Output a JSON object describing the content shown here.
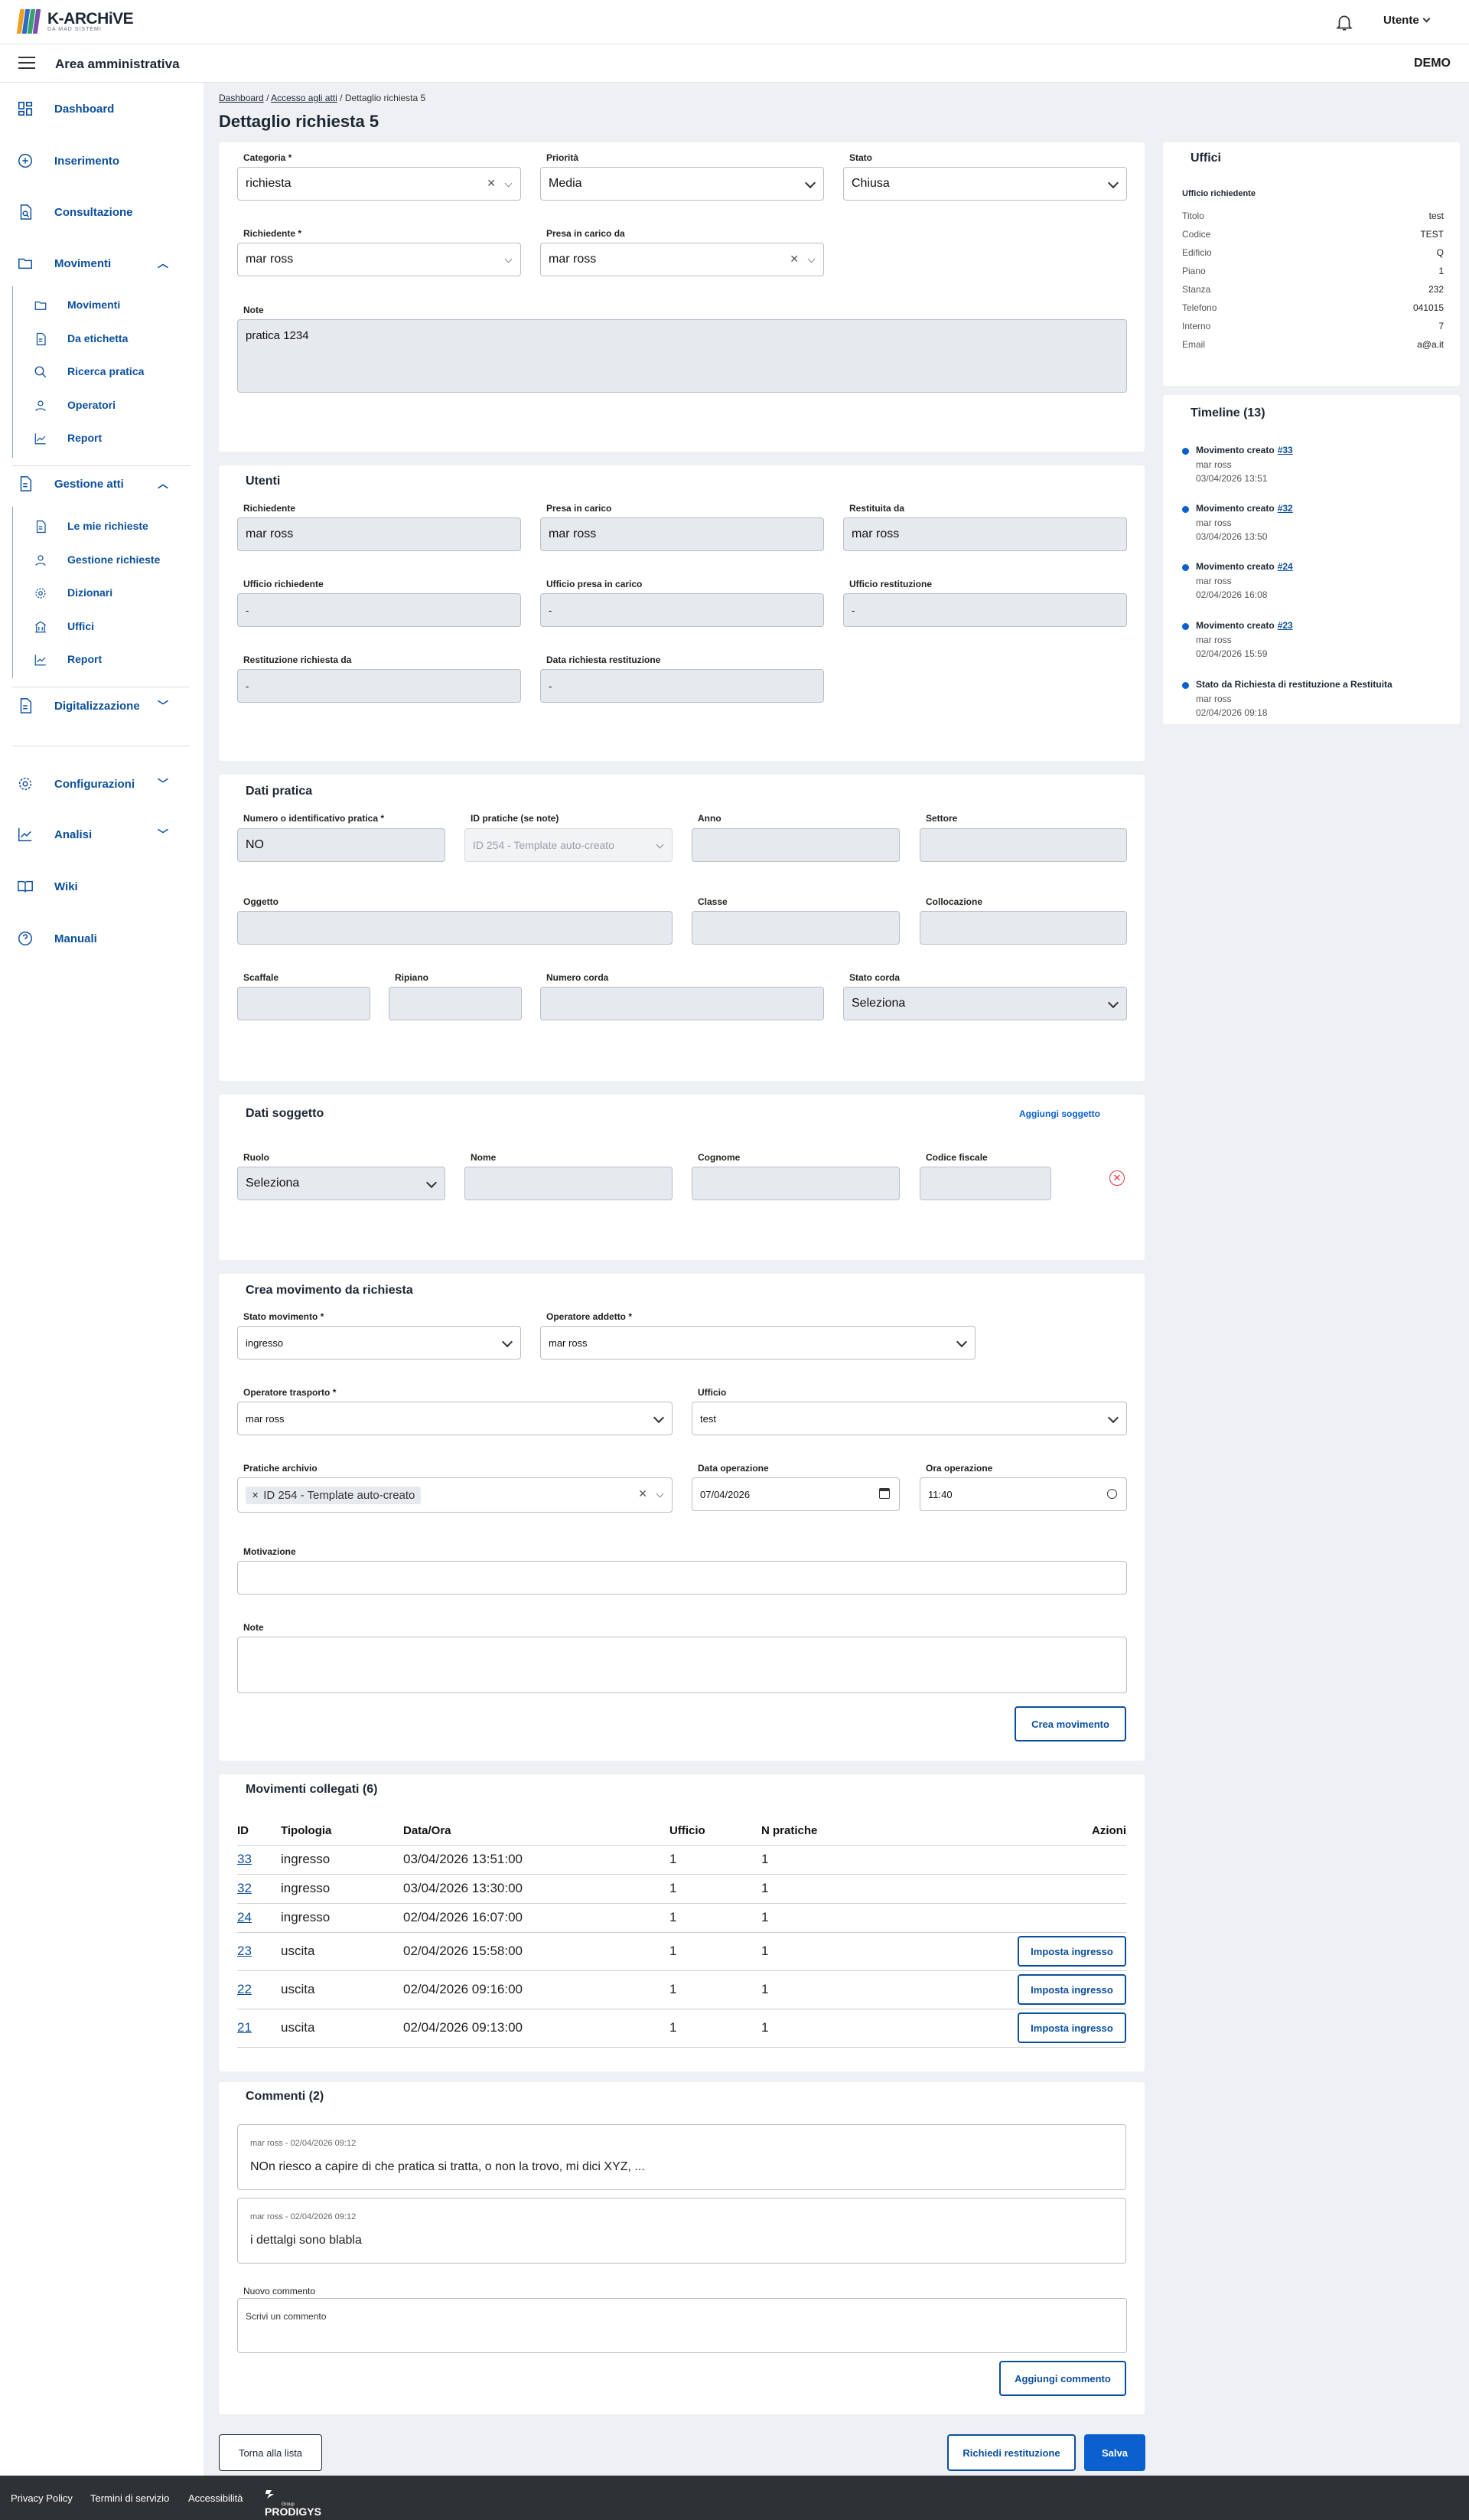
{
  "header": {
    "logo_name": "K-ARCHiVE",
    "logo_sub": "DA MAD SISTEMI",
    "user_menu": "Utente",
    "area_title": "Area amministrativa",
    "org": "DEMO"
  },
  "sidebar": {
    "dashboard": "Dashboard",
    "inserimento": "Inserimento",
    "consultazione": "Consultazione",
    "movimenti": "Movimenti",
    "movimenti_items": [
      "Movimenti",
      "Da etichetta",
      "Ricerca pratica",
      "Operatori",
      "Report"
    ],
    "gestione_atti": "Gestione atti",
    "gestione_items": [
      "Le mie richieste",
      "Gestione richieste",
      "Dizionari",
      "Uffici",
      "Report"
    ],
    "digitalizzazione": "Digitalizzazione",
    "configurazioni": "Configurazioni",
    "analisi": "Analisi",
    "wiki": "Wiki",
    "manuali": "Manuali"
  },
  "breadcrumb": {
    "b1": "Dashboard",
    "b2": "Accesso agli atti",
    "b3": "Dettaglio richiesta 5"
  },
  "page_title": "Dettaglio richiesta 5",
  "richiesta": {
    "categoria_label": "Categoria *",
    "categoria": "richiesta",
    "priorita_label": "Priorità",
    "priorita": "Media",
    "stato_label": "Stato",
    "stato": "Chiusa",
    "richiedente_label": "Richiedente *",
    "richiedente": "mar ross",
    "presa_label": "Presa in carico da",
    "presa": "mar ross",
    "note_label": "Note",
    "note": "pratica 1234"
  },
  "utenti": {
    "title": "Utenti",
    "richiedente_label": "Richiedente",
    "richiedente": "mar ross",
    "presa_label": "Presa in carico",
    "presa": "mar ross",
    "restituita_label": "Restituita da",
    "restituita": "mar ross",
    "uff_rich_label": "Ufficio richiedente",
    "uff_rich": "-",
    "uff_presa_label": "Ufficio presa in carico",
    "uff_presa": "-",
    "uff_rest_label": "Ufficio restituzione",
    "uff_rest": "-",
    "rest_rich_label": "Restituzione richiesta da",
    "rest_rich": "-",
    "data_rest_label": "Data richiesta restituzione",
    "data_rest": "-"
  },
  "pratica": {
    "title": "Dati pratica",
    "numero_label": "Numero o identificativo pratica *",
    "numero": "NO",
    "id_label": "ID pratiche (se note)",
    "id": "ID 254 - Template auto-creato",
    "anno_label": "Anno",
    "settore_label": "Settore",
    "oggetto_label": "Oggetto",
    "classe_label": "Classe",
    "collocazione_label": "Collocazione",
    "scaffale_label": "Scaffale",
    "ripiano_label": "Ripiano",
    "numero_corda_label": "Numero corda",
    "stato_corda_label": "Stato corda",
    "stato_corda": "Seleziona"
  },
  "soggetto": {
    "title": "Dati soggetto",
    "add": "Aggiungi soggetto",
    "ruolo_label": "Ruolo",
    "ruolo": "Seleziona",
    "nome_label": "Nome",
    "cognome_label": "Cognome",
    "cf_label": "Codice fiscale"
  },
  "movimento": {
    "title": "Crea movimento da richiesta",
    "stato_label": "Stato movimento *",
    "stato": "ingresso",
    "op_addetto_label": "Operatore addetto *",
    "op_addetto": "mar ross",
    "op_trasporto_label": "Operatore trasporto *",
    "op_trasporto": "mar ross",
    "ufficio_label": "Ufficio",
    "ufficio": "test",
    "pratiche_label": "Pratiche archivio",
    "pratiche": "ID 254 - Template auto-creato",
    "data_label": "Data operazione",
    "data": "07/04/2026",
    "ora_label": "Ora operazione",
    "ora": "11:40",
    "motivazione_label": "Motivazione",
    "note_label": "Note",
    "crea": "Crea movimento"
  },
  "collegati": {
    "title": "Movimenti collegati (6)",
    "headers": [
      "ID",
      "Tipologia",
      "Data/Ora",
      "Ufficio",
      "N pratiche",
      "Azioni"
    ],
    "rows": [
      {
        "id": "33",
        "tipo": "ingresso",
        "data": "03/04/2026 13:51:00",
        "uff": "1",
        "n": "1",
        "action": ""
      },
      {
        "id": "32",
        "tipo": "ingresso",
        "data": "03/04/2026 13:30:00",
        "uff": "1",
        "n": "1",
        "action": ""
      },
      {
        "id": "24",
        "tipo": "ingresso",
        "data": "02/04/2026 16:07:00",
        "uff": "1",
        "n": "1",
        "action": ""
      },
      {
        "id": "23",
        "tipo": "uscita",
        "data": "02/04/2026 15:58:00",
        "uff": "1",
        "n": "1",
        "action": "Imposta ingresso"
      },
      {
        "id": "22",
        "tipo": "uscita",
        "data": "02/04/2026 09:16:00",
        "uff": "1",
        "n": "1",
        "action": "Imposta ingresso"
      },
      {
        "id": "21",
        "tipo": "uscita",
        "data": "02/04/2026 09:13:00",
        "uff": "1",
        "n": "1",
        "action": "Imposta ingresso"
      }
    ]
  },
  "commenti": {
    "title": "Commenti (2)",
    "items": [
      {
        "meta": "mar ross - 02/04/2026 09:12",
        "text": "NOn riesco a capire di che pratica si tratta, o non la trovo, mi dici XYZ, ..."
      },
      {
        "meta": "mar ross - 02/04/2026 09:12",
        "text": "i dettalgi sono blabla"
      }
    ],
    "nuovo_label": "Nuovo commento",
    "placeholder": "Scrivi un commento",
    "add": "Aggiungi commento"
  },
  "actions": {
    "back": "Torna alla lista",
    "restituzione": "Richiedi restituzione",
    "save": "Salva"
  },
  "uffici": {
    "title": "Uffici",
    "subtitle": "Ufficio richiedente",
    "rows": [
      [
        "Titolo",
        "test"
      ],
      [
        "Codice",
        "TEST"
      ],
      [
        "Edificio",
        "Q"
      ],
      [
        "Piano",
        "1"
      ],
      [
        "Stanza",
        "232"
      ],
      [
        "Telefono",
        "041015"
      ],
      [
        "Interno",
        "7"
      ],
      [
        "Email",
        "a@a.it"
      ]
    ]
  },
  "timeline": {
    "title": "Timeline (13)",
    "items": [
      {
        "t": "Movimento creato",
        "link": "#33",
        "u": "mar ross",
        "d": "03/04/2026 13:51"
      },
      {
        "t": "Movimento creato",
        "link": "#32",
        "u": "mar ross",
        "d": "03/04/2026 13:50"
      },
      {
        "t": "Movimento creato",
        "link": "#24",
        "u": "mar ross",
        "d": "02/04/2026 16:08"
      },
      {
        "t": "Movimento creato",
        "link": "#23",
        "u": "mar ross",
        "d": "02/04/2026 15:59"
      },
      {
        "t": "Stato da Richiesta di restituzione a Restituita",
        "link": "",
        "u": "mar ross",
        "d": "02/04/2026 09:18"
      }
    ]
  },
  "footer": {
    "privacy": "Privacy Policy",
    "termini": "Termini di servizio",
    "accessibilita": "Accessibilità",
    "brand": "PRODIGYS",
    "brand_sub": "Group"
  },
  "colors": {
    "primary": "#0b4f9c",
    "button": "#0b5fcf",
    "footer": "#2e3235",
    "error": "#d9363e"
  }
}
